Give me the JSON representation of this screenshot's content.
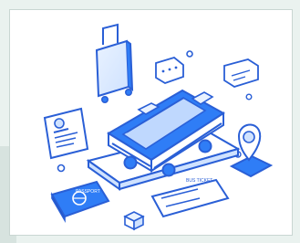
{
  "screen": {
    "ticket_text": "BUS TICKET",
    "passport_text": "PASSPORT"
  },
  "colors": {
    "accent": "#2f7df6",
    "accent_dark": "#1b4fb8",
    "accent_light": "#cfe2ff",
    "outline": "#2a5fd6",
    "background": "#eaf2ef",
    "card": "#ffffff",
    "border": "#c9d6d2"
  },
  "icons": [
    "bus-icon",
    "phone-platform-icon",
    "luggage-icon",
    "chat-bubble-icon",
    "location-pin-icon",
    "passport-icon",
    "ticket-icon",
    "id-document-icon",
    "cube-icon"
  ]
}
